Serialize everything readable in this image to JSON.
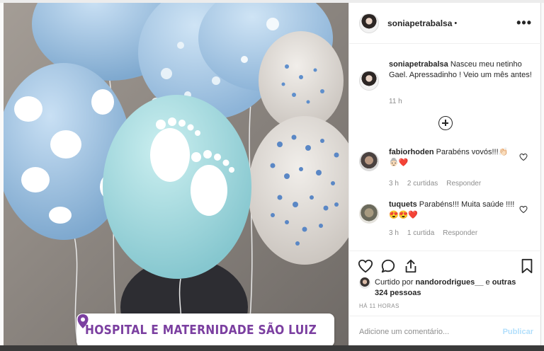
{
  "post": {
    "location": "HOSPITAL E MATERNIDADE SÃO LUIZ",
    "author": "soniapetrabalsa",
    "header_dot": "•",
    "more_icon": "more-horizontal-icon",
    "caption": {
      "username": "soniapetrabalsa",
      "text": "Nasceu meu netinho Gael. Apressadinho ! Veio um mês antes!",
      "time": "11 h"
    },
    "comments": [
      {
        "username": "fabiorhoden",
        "text": "Parabéns vovós!!!👏🏻👵🏻❤️",
        "time": "3 h",
        "likes": "2 curtidas",
        "reply": "Responder"
      },
      {
        "username": "tuquets",
        "text": "Parabéns!!! Muita saúde !!!! 😍😍❤️",
        "time": "3 h",
        "likes": "1 curtida",
        "reply": "Responder"
      }
    ],
    "liked_by": {
      "prefix": "Curtido por ",
      "user": "nandorodrigues__",
      "middle": " e ",
      "others": "outras 324 pessoas"
    },
    "ago": "HÁ 11 HORAS",
    "add_comment": {
      "placeholder": "Adicione um comentário...",
      "publish": "Publicar"
    }
  },
  "colors": {
    "location_text": "#7b3fa0",
    "publish_disabled": "#b2dffc",
    "secondary_text": "#8e8e8e",
    "primary_text": "#262626"
  }
}
